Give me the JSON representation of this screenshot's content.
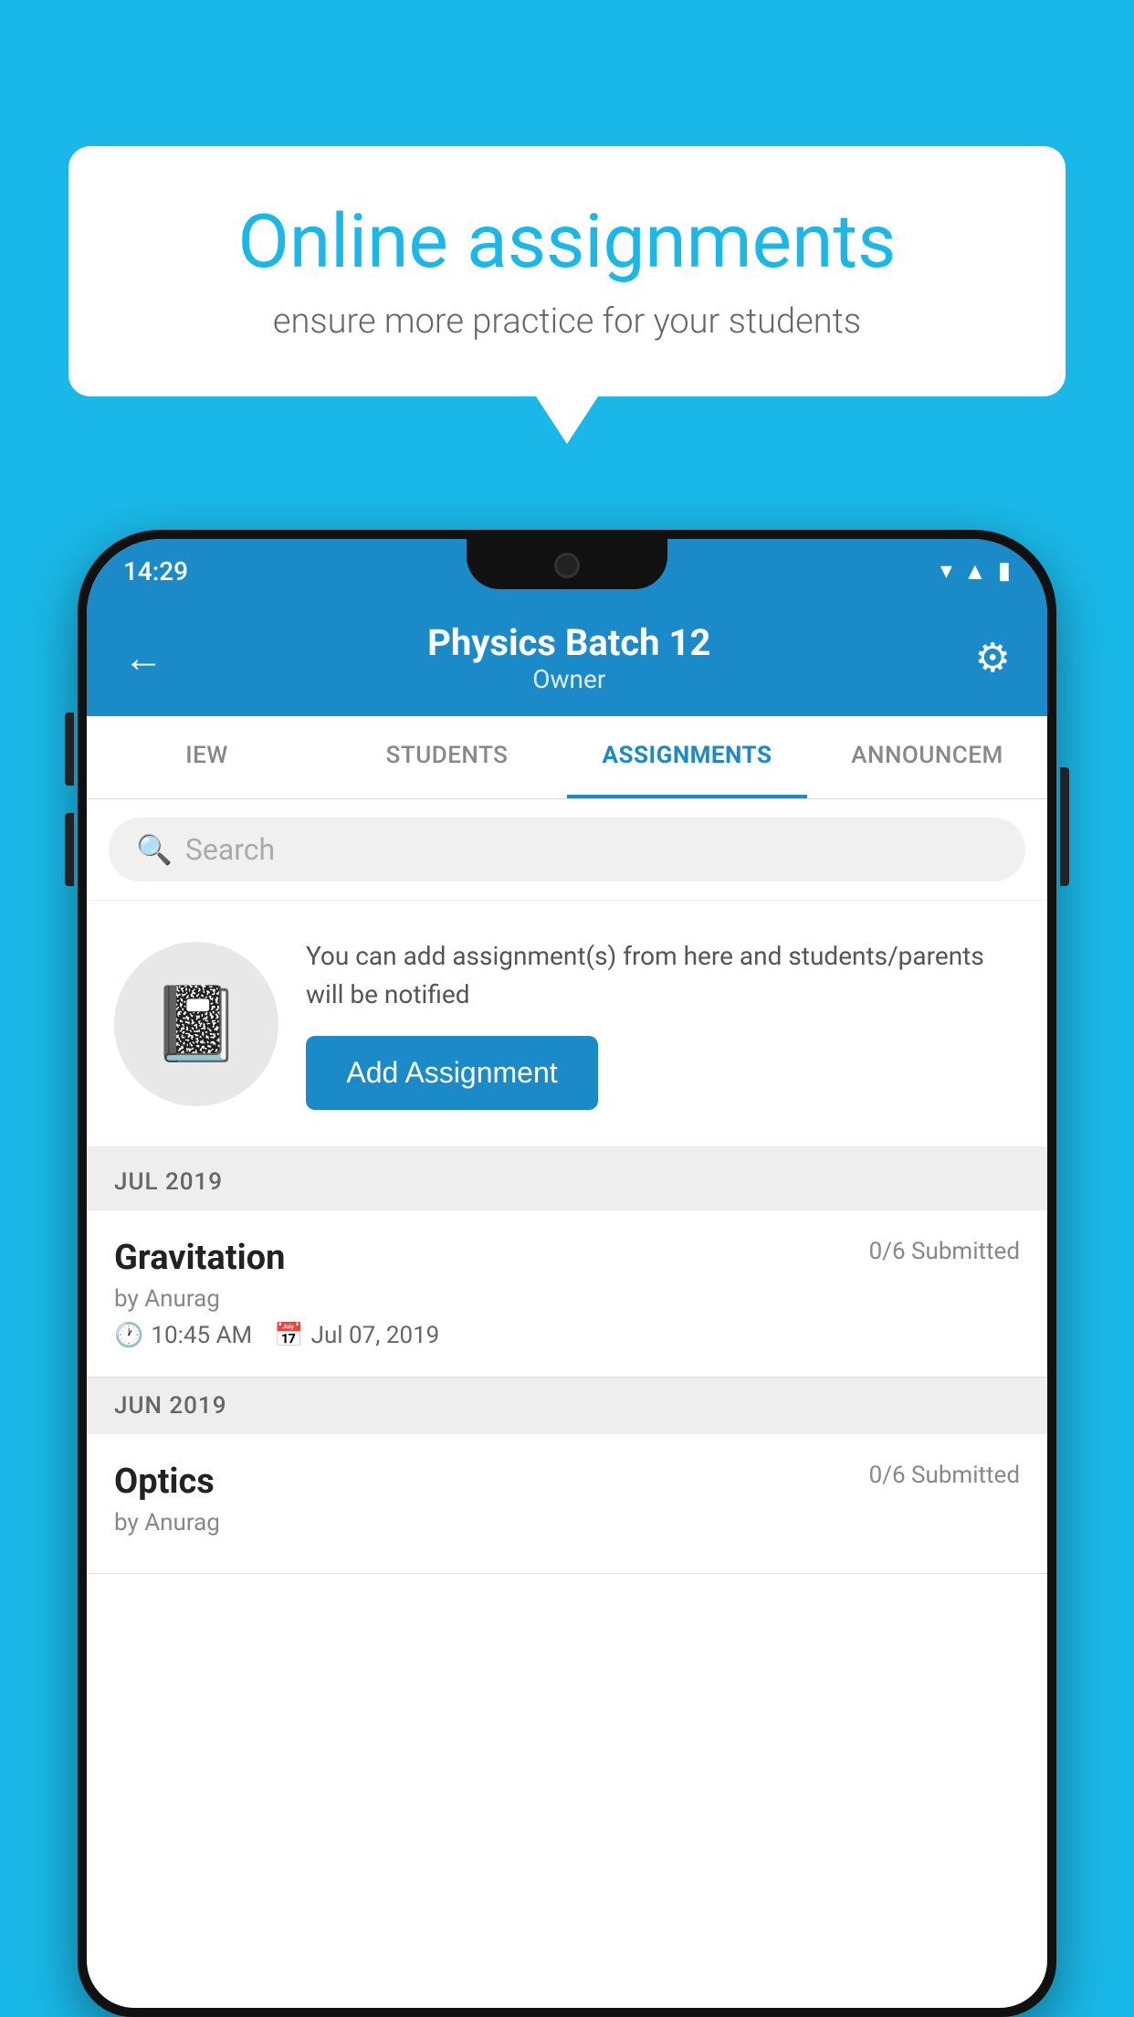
{
  "background_color": "#1ab8e8",
  "speech_bubble": {
    "title": "Online assignments",
    "subtitle": "ensure more practice for your students"
  },
  "status_bar": {
    "time": "14:29",
    "icons": [
      "wifi",
      "signal",
      "battery"
    ]
  },
  "app_header": {
    "title": "Physics Batch 12",
    "subtitle": "Owner",
    "back_label": "←",
    "settings_label": "⚙"
  },
  "tabs": [
    {
      "label": "IEW",
      "active": false
    },
    {
      "label": "STUDENTS",
      "active": false
    },
    {
      "label": "ASSIGNMENTS",
      "active": true
    },
    {
      "label": "ANNOUNCEM",
      "active": false
    }
  ],
  "search": {
    "placeholder": "Search"
  },
  "empty_state": {
    "description": "You can add assignment(s) from here and students/parents will be notified",
    "add_button_label": "Add Assignment"
  },
  "sections": [
    {
      "label": "JUL 2019",
      "assignments": [
        {
          "name": "Gravitation",
          "submitted": "0/6 Submitted",
          "author": "by Anurag",
          "time": "10:45 AM",
          "date": "Jul 07, 2019"
        }
      ]
    },
    {
      "label": "JUN 2019",
      "assignments": [
        {
          "name": "Optics",
          "submitted": "0/6 Submitted",
          "author": "by Anurag",
          "time": "",
          "date": ""
        }
      ]
    }
  ]
}
